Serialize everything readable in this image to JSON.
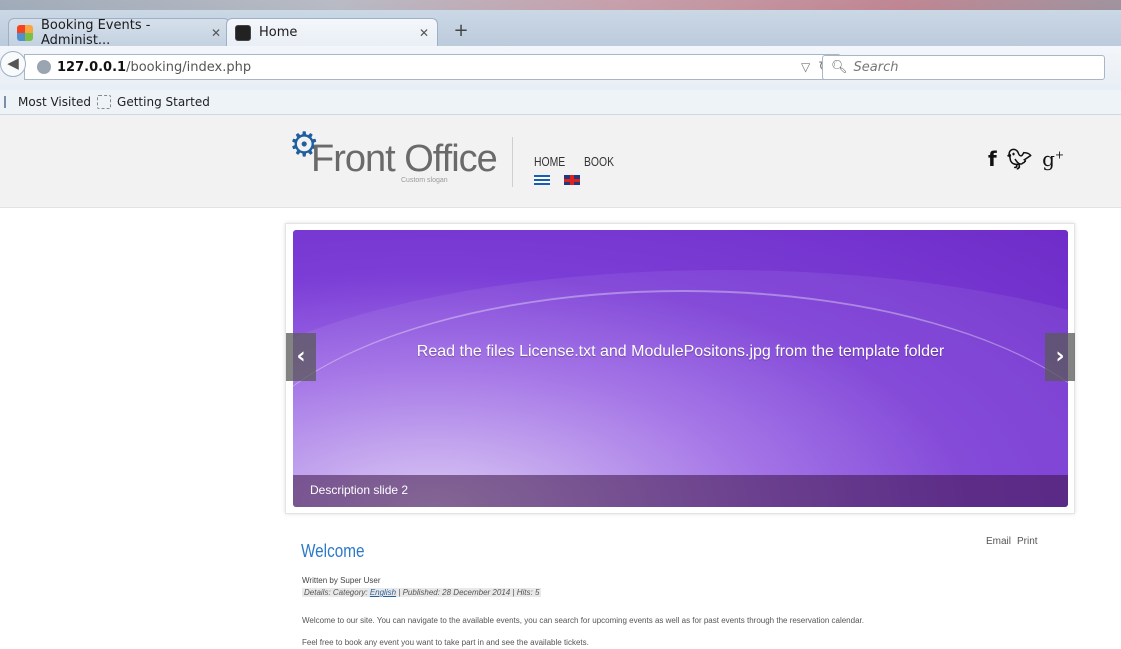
{
  "browser": {
    "tabs": [
      {
        "title": "Booking Events - Administ...",
        "active": false
      },
      {
        "title": "Home",
        "active": true
      }
    ],
    "url_host": "127.0.0.1",
    "url_path": "/booking/index.php",
    "search_placeholder": "Search",
    "bookmarks": [
      "Most Visited",
      "Getting Started"
    ]
  },
  "site": {
    "logo_text": "Front Office",
    "slogan": "Custom slogan",
    "nav": [
      "HOME",
      "BOOK"
    ],
    "languages": [
      "el",
      "en"
    ],
    "social": [
      "f",
      "twitter",
      "g+"
    ]
  },
  "slider": {
    "caption": "Read the files License.txt and ModulePositons.jpg from the template folder",
    "description": "Description slide 2",
    "colors": {
      "main": "#7b3dd6",
      "light": "#d8c6f3"
    }
  },
  "article": {
    "links": [
      "Email",
      "Print"
    ],
    "title": "Welcome",
    "byline": "Written by Super User",
    "details_prefix": "Details: Category: ",
    "category": "English",
    "details_suffix": " | Published: 28 December 2014 | Hits: 5",
    "paragraphs": [
      "Welcome to our site. You can navigate to the available events, you can search for upcoming events as well as for past events through the reservation calendar.",
      "Feel free to book any event you want to take part in and see the available tickets."
    ]
  }
}
